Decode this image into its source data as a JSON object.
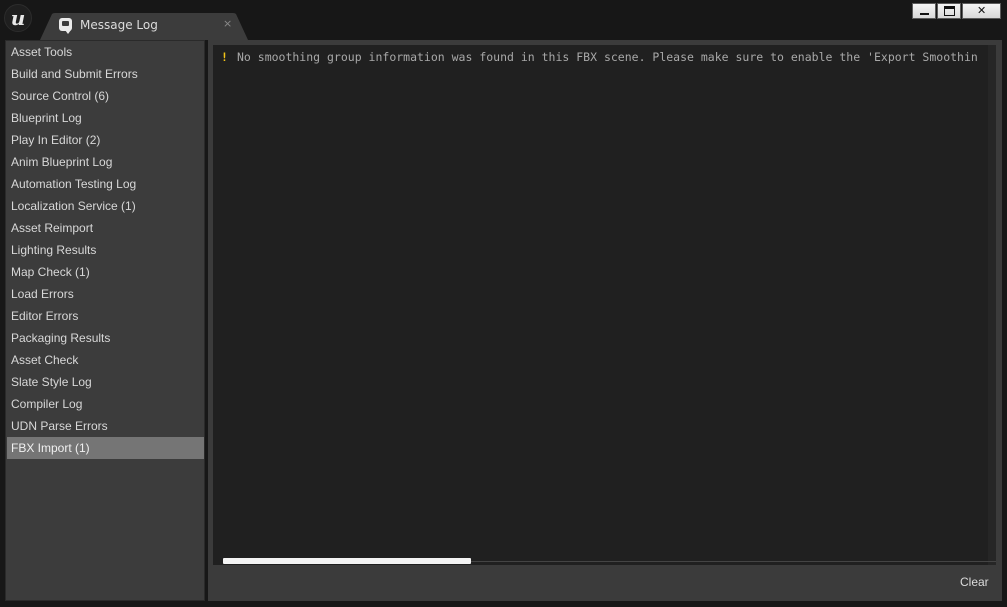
{
  "window": {
    "logo_letter": "u",
    "tab": {
      "icon": "message-bubble-icon",
      "title": "Message Log",
      "close_glyph": "×"
    },
    "controls": {
      "minimize_icon": "minimize-icon",
      "maximize_icon": "maximize-icon",
      "close_glyph": "✕"
    }
  },
  "sidebar": {
    "items": [
      {
        "label": "Asset Tools"
      },
      {
        "label": "Build and Submit Errors"
      },
      {
        "label": "Source Control (6)"
      },
      {
        "label": "Blueprint Log"
      },
      {
        "label": "Play In Editor (2)"
      },
      {
        "label": "Anim Blueprint Log"
      },
      {
        "label": "Automation Testing Log"
      },
      {
        "label": "Localization Service (1)"
      },
      {
        "label": "Asset Reimport"
      },
      {
        "label": "Lighting Results"
      },
      {
        "label": "Map Check (1)"
      },
      {
        "label": "Load Errors"
      },
      {
        "label": "Editor Errors"
      },
      {
        "label": "Packaging Results"
      },
      {
        "label": "Asset Check"
      },
      {
        "label": "Slate Style Log"
      },
      {
        "label": "Compiler Log"
      },
      {
        "label": "UDN Parse Errors"
      },
      {
        "label": "FBX Import (1)"
      }
    ],
    "selected": "FBX Import (1)"
  },
  "log": {
    "messages": [
      {
        "severity": "warning",
        "icon_glyph": "!",
        "text": "No smoothing group information was found in this FBX scene.  Please make sure to enable the 'Export Smoothin"
      }
    ]
  },
  "footer": {
    "clear_label": "Clear"
  },
  "colors": {
    "warning": "#f2c417",
    "selected_item": "#757575",
    "panel": "#3c3c3c",
    "log_background": "#202020"
  }
}
